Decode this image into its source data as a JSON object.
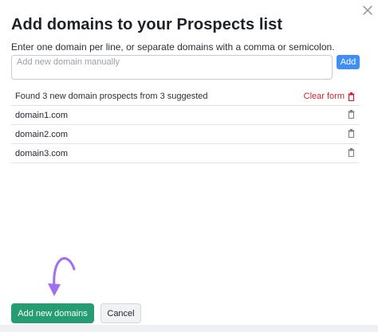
{
  "dialog": {
    "title": "Add domains to your Prospects list",
    "instructions": "Enter one domain per line, or separate domains with a comma or semicolon.",
    "input": {
      "placeholder": "Add new domain manually",
      "value": ""
    },
    "add_label": "Add",
    "summary": "Found 3 new domain prospects from 3 suggested",
    "clear_label": "Clear form",
    "domains": [
      {
        "label": "domain1.com"
      },
      {
        "label": "domain2.com"
      },
      {
        "label": "domain3.com"
      }
    ],
    "primary_label": "Add new domains",
    "cancel_label": "Cancel"
  },
  "icons": {
    "close": "close-icon",
    "clear": "trash-icon",
    "row_delete": "trash-icon",
    "annotation": "curved-arrow-icon"
  },
  "colors": {
    "primary": "#259c72",
    "add_button": "#3e8ef7",
    "danger": "#d1242f",
    "annotation_arrow": "#a06ef0"
  }
}
